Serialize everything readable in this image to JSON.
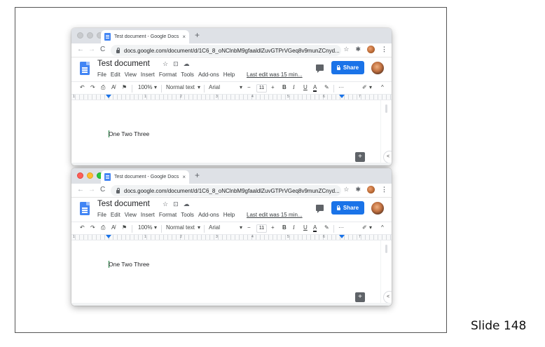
{
  "slide": {
    "label": "Slide 148"
  },
  "browser": {
    "tab_title": "Test document - Google Docs",
    "tab_close": "×",
    "new_tab": "+",
    "url": "docs.google.com/document/d/1C6_8_oNClnbM9gfaaldlZuvGTPrVGeq8v9munZCnyd...",
    "nav": {
      "back": "←",
      "forward": "→",
      "reload": "C"
    },
    "star": "☆",
    "extensions": "✱",
    "menu": "⋮"
  },
  "docs": {
    "title": "Test document",
    "title_icons": {
      "star": "☆",
      "move": "⊡",
      "cloud": "☁"
    },
    "menu": [
      "File",
      "Edit",
      "View",
      "Insert",
      "Format",
      "Tools",
      "Add-ons",
      "Help"
    ],
    "last_edit": "Last edit was 15 min...",
    "share_label": "Share",
    "body_text": "One Two Three",
    "explore": "+",
    "side_toggle": "<"
  },
  "toolbar": {
    "undo": "↶",
    "redo": "↷",
    "print": "⎙",
    "spellcheck": "A̸",
    "paint_format": "⚑",
    "zoom": "100%",
    "style": "Normal text",
    "font": "Arial",
    "size_minus": "−",
    "font_size": "11",
    "size_plus": "+",
    "bold": "B",
    "italic": "I",
    "underline": "U",
    "text_color": "A",
    "highlight": "✎",
    "more": "···",
    "editing": "✐",
    "collapse": "^",
    "dropdown": "▾"
  },
  "ruler": {
    "numbers": [
      "1",
      "1",
      "2",
      "3",
      "4",
      "5",
      "6",
      "7"
    ]
  },
  "windows": [
    {
      "id": "top",
      "traffic_lights": [
        "grey",
        "grey",
        "grey"
      ]
    },
    {
      "id": "bottom",
      "traffic_lights": [
        "red",
        "yellow",
        "green"
      ]
    }
  ],
  "colors": {
    "share_blue": "#1a73e8",
    "docs_blue": "#4285f4",
    "cursor_green": "#188038",
    "tab_strip": "#dee1e6"
  }
}
